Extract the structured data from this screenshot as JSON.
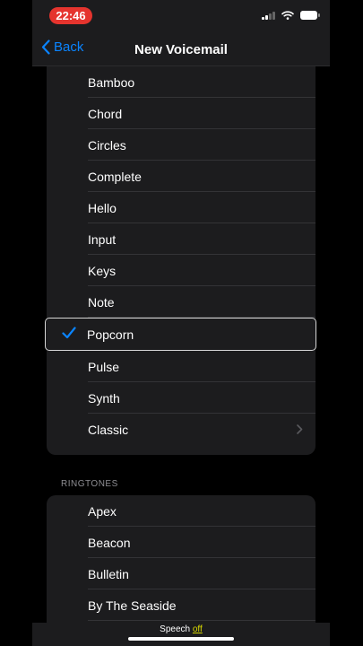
{
  "status_bar": {
    "time": "22:46"
  },
  "nav": {
    "back_label": "Back",
    "title": "New Voicemail"
  },
  "alert_tones": [
    {
      "label": "Bamboo",
      "selected": false
    },
    {
      "label": "Chord",
      "selected": false
    },
    {
      "label": "Circles",
      "selected": false
    },
    {
      "label": "Complete",
      "selected": false
    },
    {
      "label": "Hello",
      "selected": false
    },
    {
      "label": "Input",
      "selected": false
    },
    {
      "label": "Keys",
      "selected": false
    },
    {
      "label": "Note",
      "selected": false
    },
    {
      "label": "Popcorn",
      "selected": true
    },
    {
      "label": "Pulse",
      "selected": false
    },
    {
      "label": "Synth",
      "selected": false
    },
    {
      "label": "Classic",
      "selected": false,
      "has_chevron": true
    }
  ],
  "ringtones": {
    "header": "RINGTONES",
    "items": [
      "Apex",
      "Beacon",
      "Bulletin",
      "By The Seaside"
    ]
  },
  "bottom_bar": {
    "speech_label": "Speech",
    "speech_state": "off"
  },
  "colors": {
    "accent": "#0a84ff",
    "background": "#000000",
    "cell": "#1c1c1e",
    "status_pill": "#e5342e",
    "speech_state": "#d9d900"
  },
  "icons": {
    "back": "chevron-left-icon",
    "check": "checkmark-icon",
    "disclosure": "chevron-right-icon"
  }
}
